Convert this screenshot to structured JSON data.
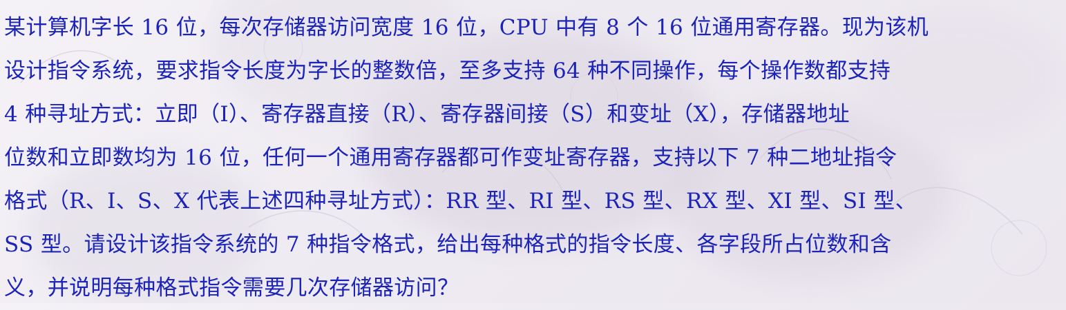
{
  "problem": {
    "lines": [
      "某计算机字长 16 位，每次存储器访问宽度 16 位，CPU 中有 8 个 16 位通用寄存器。现为该机",
      "设计指令系统，要求指令长度为字长的整数倍，至多支持 64 种不同操作，每个操作数都支持",
      "4 种寻址方式：立即（I）、寄存器直接（R）、寄存器间接（S）和变址（X），存储器地址",
      "位数和立即数均为 16 位，任何一个通用寄存器都可作变址寄存器，支持以下 7 种二地址指令",
      "格式（R、I、S、X 代表上述四种寻址方式）：RR 型、RI 型、RS 型、RX 型、XI 型、SI 型、",
      "SS 型。请设计该指令系统的 7 种指令格式，给出每种格式的指令长度、各字段所占位数和含",
      "义，并说明每种格式指令需要几次存储器访问？"
    ]
  },
  "colors": {
    "text": "#1c24b8",
    "background": "#efebf2"
  }
}
